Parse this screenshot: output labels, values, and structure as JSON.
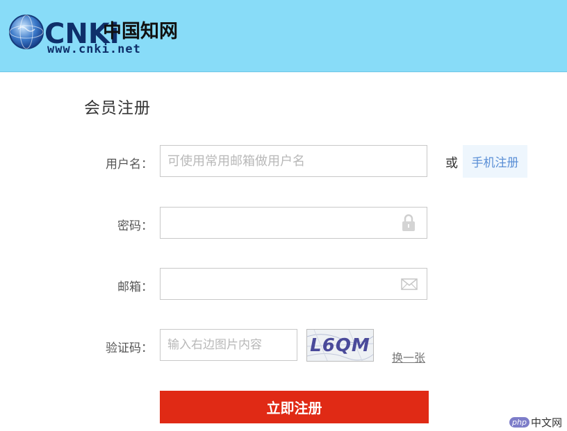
{
  "header": {
    "logo_cnki": "CNKi",
    "logo_chinese": "中国知网",
    "logo_url": "www.cnki.net"
  },
  "page_title": "会员注册",
  "form": {
    "username": {
      "label": "用户名：",
      "placeholder": "可使用常用邮箱做用户名",
      "value": ""
    },
    "or_text": "或",
    "phone_register_label": "手机注册",
    "password": {
      "label": "密码：",
      "value": "",
      "icon": "lock-icon"
    },
    "email": {
      "label": "邮箱：",
      "value": "",
      "icon": "envelope-icon"
    },
    "captcha": {
      "label": "验证码：",
      "placeholder": "输入右边图片内容",
      "value": "",
      "image_text": "L6QM"
    },
    "refresh_label": "换一张",
    "submit_label": "立即注册"
  },
  "watermark": {
    "badge": "php",
    "text": "中文网"
  },
  "colors": {
    "header_bg": "#88dcf8",
    "submit_bg": "#e02a15",
    "link": "#5a8fd6"
  }
}
